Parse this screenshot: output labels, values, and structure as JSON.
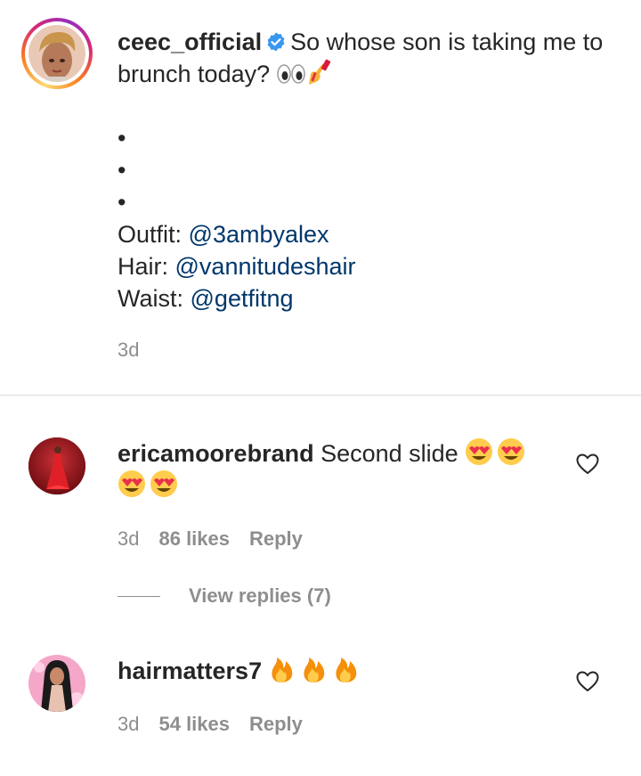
{
  "caption": {
    "username": "ceec_official",
    "text": "So whose son is taking me to brunch today?",
    "emojis_icon": "eyes-and-nail-polish-emoji",
    "bullets": [
      "•",
      "•",
      "•"
    ],
    "credits": [
      {
        "label": "Outfit: ",
        "mention": "@3ambyalex"
      },
      {
        "label": "Hair: ",
        "mention": "@vannitudeshair"
      },
      {
        "label": "Waist: ",
        "mention": "@getfitng"
      }
    ],
    "time": "3d"
  },
  "comments": [
    {
      "username": "ericamoorebrand",
      "text": "Second slide",
      "emoji_icon": "heart-eyes-emoji",
      "emoji_count": 4,
      "time": "3d",
      "likes": "86 likes",
      "reply_label": "Reply",
      "view_replies": "View replies (7)"
    },
    {
      "username": "hairmatters7",
      "text": "",
      "emoji_icon": "fire-emoji",
      "emoji_count": 3,
      "time": "3d",
      "likes": "54 likes",
      "reply_label": "Reply"
    }
  ],
  "colors": {
    "text": "#262626",
    "secondary": "#8e8e8e",
    "mention": "#00376b",
    "verified": "#3897f0",
    "divider": "#dbdbdb"
  }
}
